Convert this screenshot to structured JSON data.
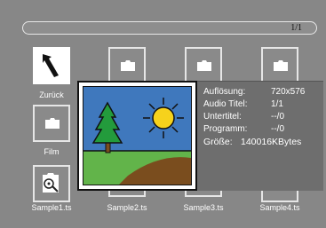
{
  "header": {
    "page_indicator": "1/1"
  },
  "grid": {
    "back_label": "Zurück",
    "film_label": "Film",
    "files": [
      {
        "label": "Sample1.ts"
      },
      {
        "label": "Sample2.ts"
      },
      {
        "label": "Sample3.ts"
      },
      {
        "label": "Sample4.ts"
      }
    ]
  },
  "info": {
    "resolution_label": "Auflösung:",
    "resolution_value": "720x576",
    "audio_label": "Audio Titel:",
    "audio_value": "1/1",
    "subtitle_label": "Untertitel:",
    "subtitle_value": "--/0",
    "program_label": "Programm:",
    "program_value": "--/0",
    "size_label": "Größe:",
    "size_value": "140016KBytes"
  },
  "icons": {
    "back": "back-arrow-icon",
    "folder": "folder-icon",
    "video_file": "video-file-icon",
    "preview": "landscape-picture-icon"
  }
}
